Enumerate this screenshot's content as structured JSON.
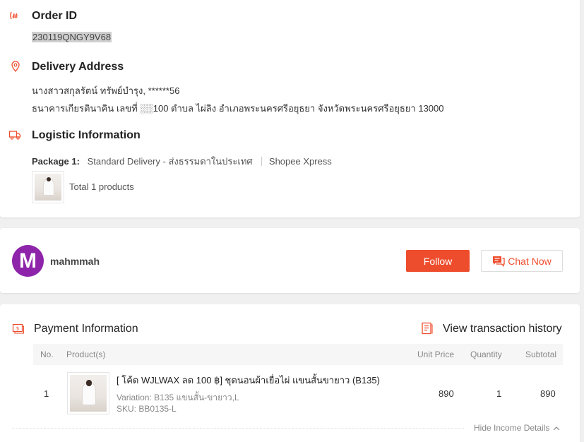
{
  "order": {
    "title": "Order ID",
    "value": "230119QNGY9V68"
  },
  "delivery": {
    "title": "Delivery Address",
    "line1": "นางสาวสกุลรัตน์ ทรัพย์บำรุง, ******56",
    "line2": "ธนาคารเกียรตินาคิน เลขที่ ░░100 ตำบล ไผ่ลิง อำเภอพระนครศรีอยุธยา จังหวัดพระนครศรีอยุธยา 13000"
  },
  "logistic": {
    "title": "Logistic Information",
    "package_label": "Package 1:",
    "delivery_type": "Standard Delivery - ส่งธรรมดาในประเทศ",
    "carrier": "Shopee Xpress",
    "total_products": "Total 1 products"
  },
  "buyer": {
    "avatar_letter": "M",
    "username": "mahmmah",
    "follow_label": "Follow",
    "chat_label": "Chat Now"
  },
  "payment": {
    "title": "Payment Information",
    "history_label": "View transaction history",
    "columns": {
      "no": "No.",
      "product": "Product(s)",
      "unit_price": "Unit Price",
      "quantity": "Quantity",
      "subtotal": "Subtotal"
    },
    "rows": [
      {
        "no": "1",
        "name": "[ โค้ด WJLWAX ลด 100 ฿] ชุดนอนผ้าเยื่อไผ่ แขนสั้นขายาว (B135)",
        "variation": "Variation: B135 แขนสั้น-ขายาว,L",
        "sku": "SKU: BB0135-L",
        "unit_price": "890",
        "quantity": "1",
        "subtotal": "890"
      }
    ],
    "hide_income_label": "Hide Income Details"
  },
  "colors": {
    "accent": "#ee4d2d",
    "avatar": "#8e24aa"
  }
}
